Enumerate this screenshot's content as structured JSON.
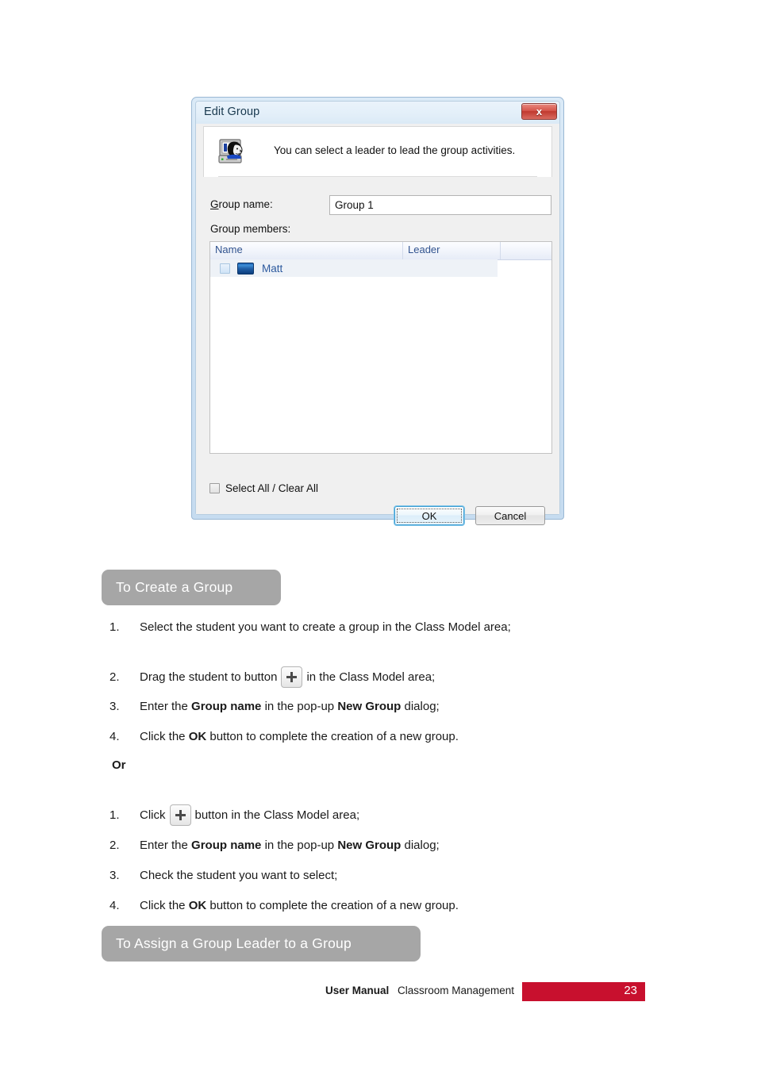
{
  "dialog": {
    "title": "Edit Group",
    "close_label": "x",
    "header_message": "You can select a leader to lead the group activities.",
    "group_name_label": "Group name:",
    "group_name_value": "Group 1",
    "group_members_label": "Group members:",
    "columns": [
      "Name",
      "Leader",
      ""
    ],
    "rows": [
      {
        "name": "Matt",
        "leader": "",
        "checked": false
      }
    ],
    "select_all_label": "Select All / Clear All",
    "ok_label": "OK",
    "cancel_label": "Cancel"
  },
  "sections": [
    {
      "heading": "To Create a Group",
      "lists": [
        {
          "steps": [
            {
              "num": "1.",
              "pre": "Select the student you want to create a group in the Class Model area;",
              "bold": "",
              "post": "",
              "icon": false
            },
            {
              "num": "2.",
              "pre": "Drag the student to button",
              "bold": "",
              "post": "in the Class Model area;",
              "icon": true
            },
            {
              "num": "3.",
              "pre": "Enter the ",
              "bold": "Group name",
              "mid": " in the pop-up ",
              "bold2": "New Group",
              "post": " dialog;",
              "icon": false
            },
            {
              "num": "4.",
              "pre": "Click the ",
              "bold": "OK",
              "post": " button to complete the creation of a new group.",
              "icon": false
            }
          ]
        },
        {
          "separator": "Or",
          "steps": [
            {
              "num": "1.",
              "pre": "Click",
              "bold": "",
              "post": "button in the Class Model area;",
              "icon": true
            },
            {
              "num": "2.",
              "pre": "Enter the ",
              "bold": "Group name",
              "mid": " in the pop-up ",
              "bold2": "New Group",
              "post": " dialog;",
              "icon": false
            },
            {
              "num": "3.",
              "pre": "Check the student you want to select;",
              "bold": "",
              "post": "",
              "icon": false
            },
            {
              "num": "4.",
              "pre": "Click the ",
              "bold": "OK",
              "post": " button to complete the creation of a new group.",
              "icon": false
            }
          ]
        }
      ]
    },
    {
      "heading": "To Assign a Group Leader to a Group",
      "lists": []
    }
  ],
  "footer": {
    "doc_type": "User Manual",
    "product": "Classroom Management",
    "page_number": "23",
    "accent_color": "#C8102E"
  }
}
